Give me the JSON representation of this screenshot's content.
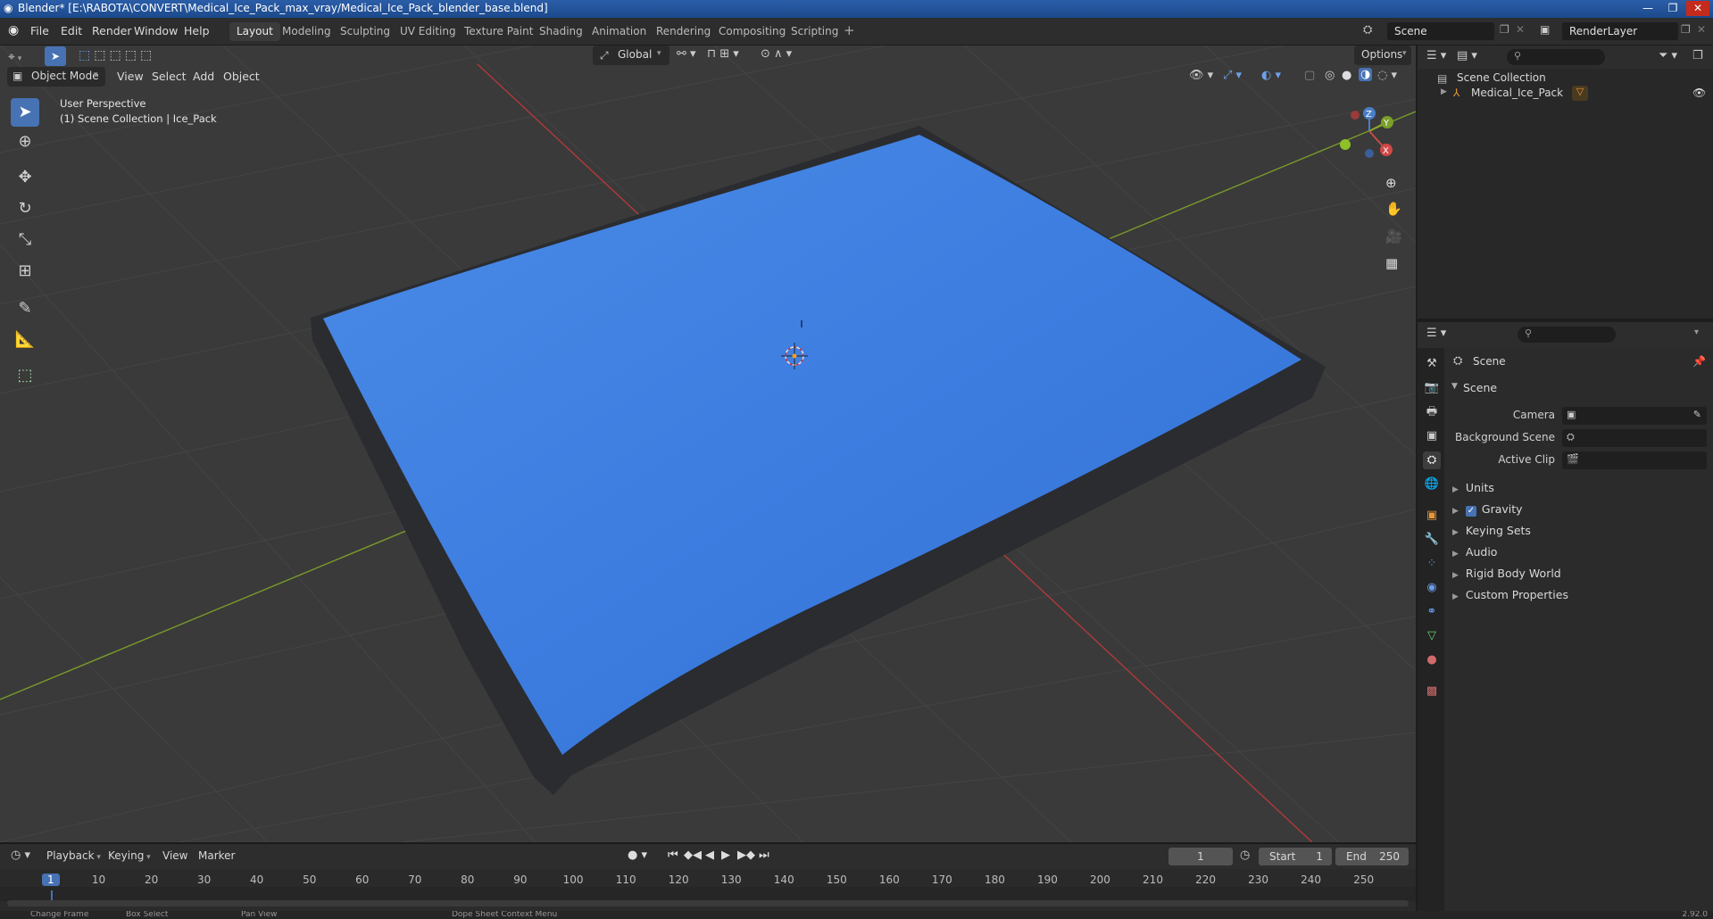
{
  "titlebar": {
    "title": "Blender* [E:\\RABOTA\\CONVERT\\Medical_Ice_Pack_max_vray/Medical_Ice_Pack_blender_base.blend]",
    "minimize": "—",
    "maximize": "❐",
    "close": "✕"
  },
  "menu": {
    "file": "File",
    "edit": "Edit",
    "render": "Render",
    "window": "Window",
    "help": "Help"
  },
  "workspaces": [
    "Layout",
    "Modeling",
    "Sculpting",
    "UV Editing",
    "Texture Paint",
    "Shading",
    "Animation",
    "Rendering",
    "Compositing",
    "Scripting"
  ],
  "workspace_add": "+",
  "scene_field": "Scene",
  "renderlayer_field": "RenderLayer",
  "viewport": {
    "mode": "Object Mode",
    "view": "View",
    "select": "Select",
    "add": "Add",
    "object": "Object",
    "transform_orientation": "Global",
    "options": "Options",
    "perspective_label": "User Perspective",
    "collection_label": "(1) Scene Collection | Ice_Pack",
    "gizmo": {
      "x": "X",
      "y": "Y",
      "z": "Z"
    },
    "colors": {
      "mesh": "#3d7de0",
      "x_axis": "#b03a3a",
      "y_axis": "#7a9a2a",
      "grid": "#454545"
    }
  },
  "outliner": {
    "root": "Scene Collection",
    "items": [
      {
        "label": "Medical_Ice_Pack"
      }
    ]
  },
  "properties": {
    "header": "Scene",
    "section": "Scene",
    "rows": [
      {
        "label": "Camera"
      },
      {
        "label": "Background Scene"
      },
      {
        "label": "Active Clip"
      }
    ],
    "panels": [
      "Units",
      "Gravity",
      "Keying Sets",
      "Audio",
      "Rigid Body World",
      "Custom Properties"
    ],
    "gravity_checked": true
  },
  "timeline": {
    "playback": "Playback",
    "keying": "Keying",
    "view": "View",
    "marker": "Marker",
    "current_frame": "1",
    "start_label": "Start",
    "start_value": "1",
    "end_label": "End",
    "end_value": "250",
    "ticks": [
      "1",
      "10",
      "20",
      "30",
      "40",
      "50",
      "60",
      "70",
      "80",
      "90",
      "100",
      "110",
      "120",
      "130",
      "140",
      "150",
      "160",
      "170",
      "180",
      "190",
      "200",
      "210",
      "220",
      "230",
      "240",
      "250"
    ]
  },
  "statusbar": {
    "items": [
      "Change Frame",
      "Box Select",
      "Pan View",
      "Dope Sheet Context Menu"
    ],
    "version": "2.92.0"
  }
}
